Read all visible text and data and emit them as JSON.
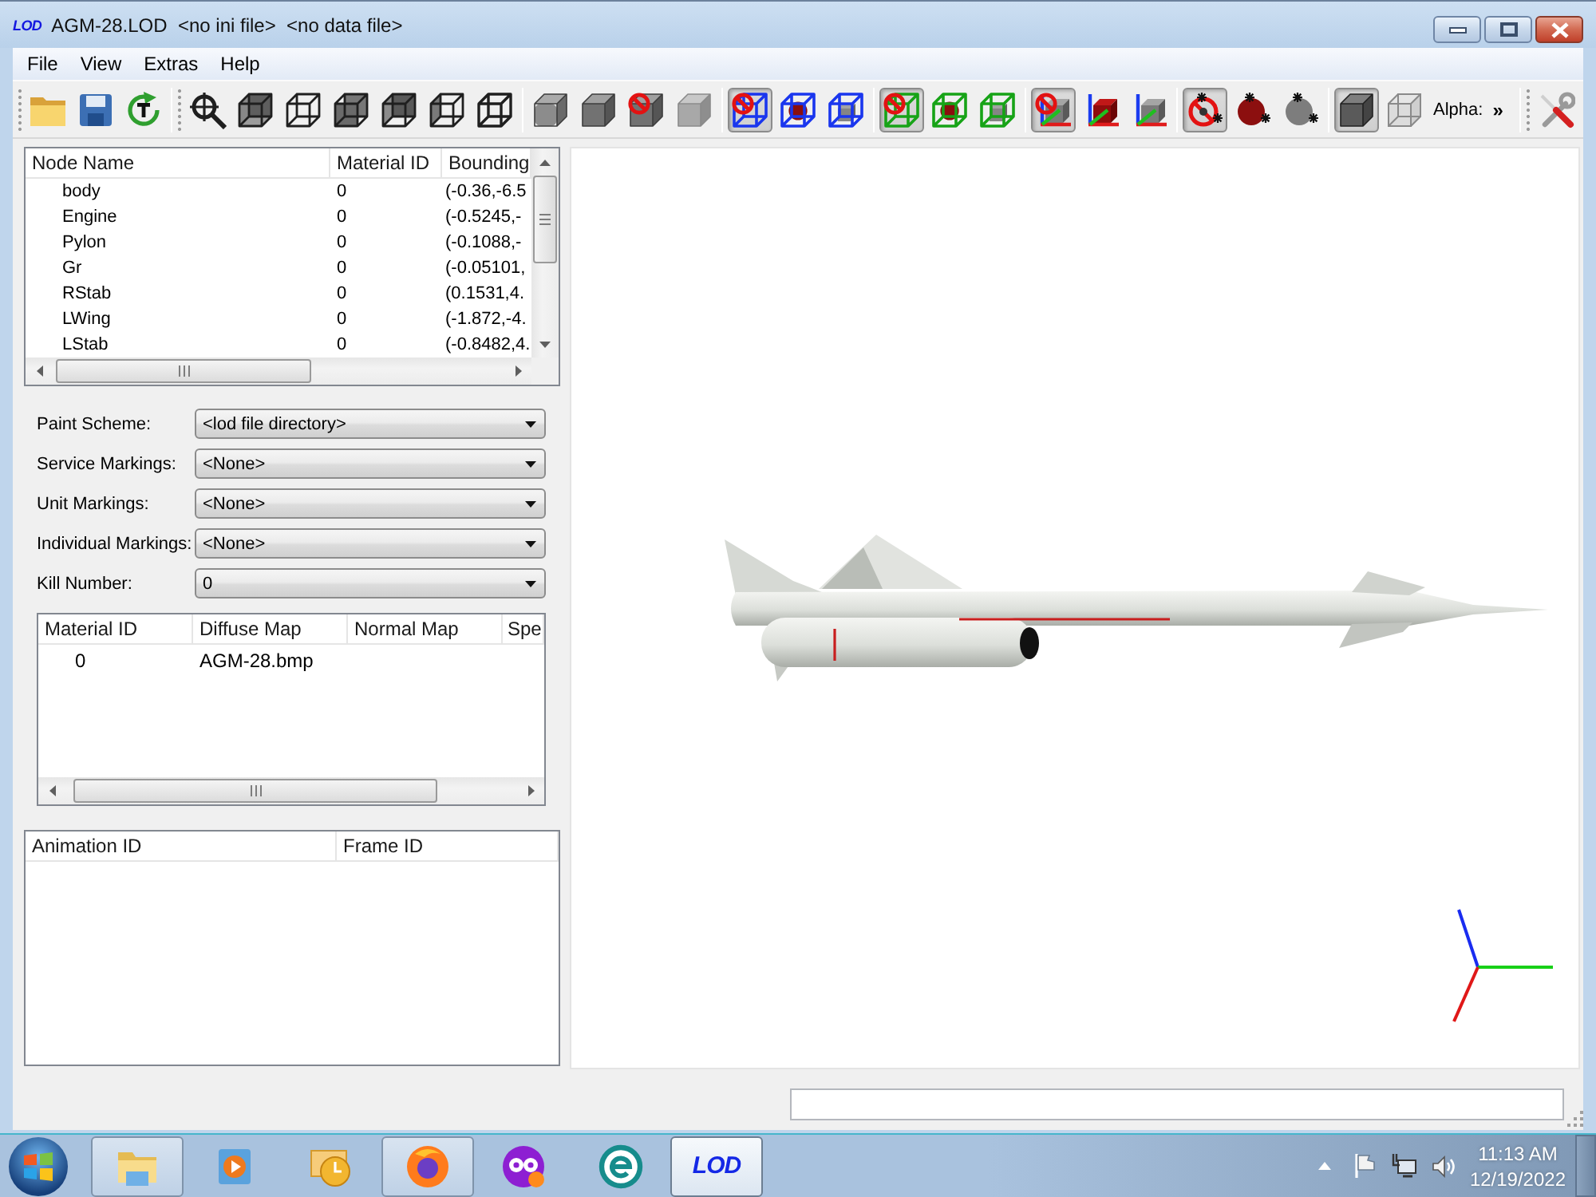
{
  "window": {
    "logo": "LOD",
    "title": "AGM-28.LOD  <no ini file>  <no data file>"
  },
  "menu": [
    "File",
    "View",
    "Extras",
    "Help"
  ],
  "toolbar": {
    "items": [
      {
        "kind": "grip"
      },
      {
        "kind": "button",
        "pressed": false
      },
      {
        "kind": "button",
        "pressed": false
      },
      {
        "kind": "button",
        "pressed": false
      },
      {
        "kind": "separator"
      },
      {
        "kind": "grip"
      },
      {
        "kind": "button",
        "pressed": false
      },
      {
        "kind": "button",
        "pressed": false
      },
      {
        "kind": "button",
        "pressed": false
      },
      {
        "kind": "button",
        "pressed": false
      },
      {
        "kind": "button",
        "pressed": false
      },
      {
        "kind": "button",
        "pressed": false
      },
      {
        "kind": "button",
        "pressed": false
      },
      {
        "kind": "separator"
      },
      {
        "kind": "button",
        "pressed": false
      },
      {
        "kind": "button",
        "pressed": false
      },
      {
        "kind": "button",
        "pressed": false
      },
      {
        "kind": "button",
        "pressed": false
      },
      {
        "kind": "separator"
      },
      {
        "kind": "button",
        "pressed": true
      },
      {
        "kind": "button",
        "pressed": false
      },
      {
        "kind": "button",
        "pressed": false
      },
      {
        "kind": "separator"
      },
      {
        "kind": "button",
        "pressed": true
      },
      {
        "kind": "button",
        "pressed": false
      },
      {
        "kind": "button",
        "pressed": false
      },
      {
        "kind": "separator"
      },
      {
        "kind": "button",
        "pressed": true
      },
      {
        "kind": "button",
        "pressed": false
      },
      {
        "kind": "button",
        "pressed": false
      },
      {
        "kind": "separator"
      },
      {
        "kind": "button",
        "pressed": true
      },
      {
        "kind": "button",
        "pressed": false
      },
      {
        "kind": "button",
        "pressed": false
      },
      {
        "kind": "separator"
      },
      {
        "kind": "button",
        "pressed": true
      },
      {
        "kind": "button",
        "pressed": false
      },
      {
        "kind": "label",
        "text": "Alpha:"
      },
      {
        "kind": "overflow",
        "text": "»"
      },
      {
        "kind": "separator"
      },
      {
        "kind": "grip"
      },
      {
        "kind": "button",
        "pressed": false
      }
    ]
  },
  "node_table": {
    "columns": [
      "Node Name",
      "Material ID",
      "Bounding"
    ],
    "rows": [
      [
        "body",
        "0",
        "(-0.36,-6.5"
      ],
      [
        "Engine",
        "0",
        "(-0.5245,-"
      ],
      [
        "Pylon",
        "0",
        "(-0.1088,-"
      ],
      [
        "Gr",
        "0",
        "(-0.05101,"
      ],
      [
        "RStab",
        "0",
        "(0.1531,4."
      ],
      [
        "LWing",
        "0",
        "(-1.872,-4."
      ],
      [
        "LStab",
        "0",
        "(-0.8482,4."
      ]
    ]
  },
  "markings": [
    {
      "label": "Paint Scheme:",
      "value": "<lod file directory>"
    },
    {
      "label": "Service Markings:",
      "value": "<None>"
    },
    {
      "label": "Unit Markings:",
      "value": "<None>"
    },
    {
      "label": "Individual Markings:",
      "value": "<None>"
    },
    {
      "label": "Kill Number:",
      "value": "0"
    }
  ],
  "material_table": {
    "columns": [
      "Material ID",
      "Diffuse Map",
      "Normal Map",
      "Spe"
    ],
    "rows": [
      [
        "0",
        "AGM-28.bmp"
      ]
    ]
  },
  "animation_table": {
    "columns": [
      "Animation ID",
      "Frame ID"
    ]
  },
  "taskbar": {
    "apps": [
      {
        "running": true,
        "selected": false
      },
      {
        "running": false,
        "selected": false
      },
      {
        "running": false,
        "selected": false
      },
      {
        "running": true,
        "selected": false
      },
      {
        "running": false,
        "selected": false
      },
      {
        "running": false,
        "selected": false
      },
      {
        "label": "LOD",
        "running": true,
        "selected": true
      }
    ],
    "clock": {
      "time": "11:13 AM",
      "date": "12/19/2022"
    }
  }
}
